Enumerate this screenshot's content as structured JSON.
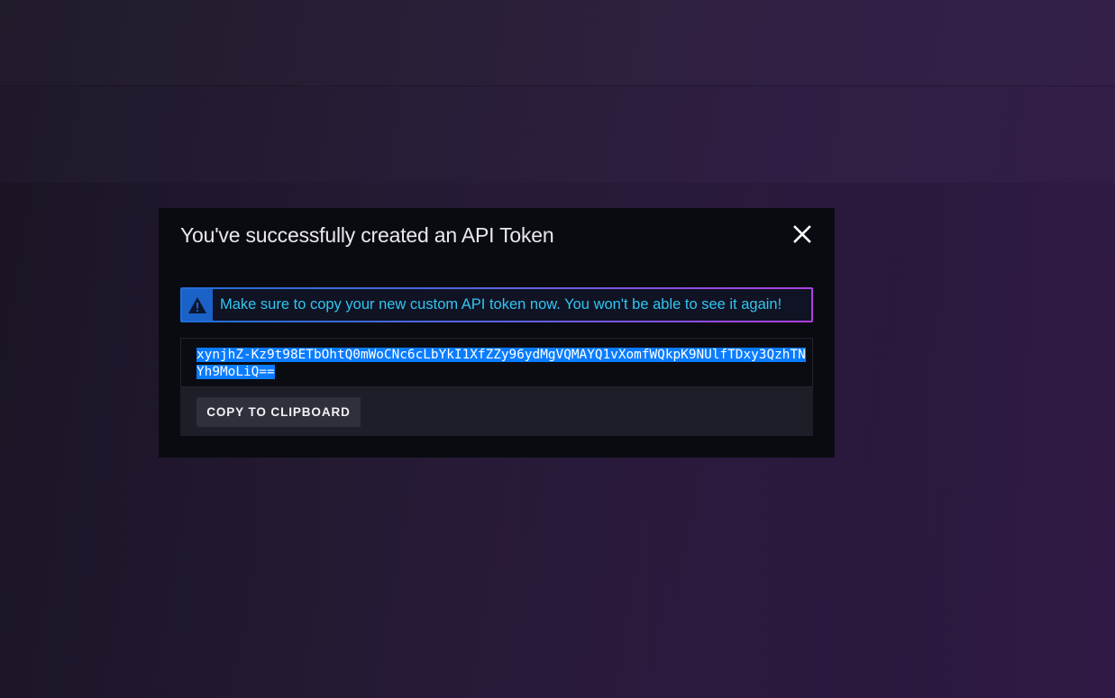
{
  "modal": {
    "title": "You've successfully created an API Token",
    "close_icon": "close-icon"
  },
  "alert": {
    "icon": "warning-triangle-icon",
    "message": "Make sure to copy your new custom API token now. You won't be able to see it again!",
    "colors": {
      "icon_bg": "#1a62c8",
      "text": "#33c5f0",
      "border_start": "#1f6fd6",
      "border_end": "#b041e0"
    }
  },
  "token": {
    "value": "xynjhZ-Kz9t98ETbOhtQ0mWoCNc6cLbYkI1XfZZy96ydMgVQMAYQ1vXomfWQkpK9NUlfTDxy3QzhTNYh9MoLiQ==",
    "selected": true,
    "selection_color": "#0a7cff"
  },
  "actions": {
    "copy_label": "COPY TO CLIPBOARD"
  },
  "colors": {
    "modal_bg": "#0a0b11",
    "page_bg": "#2c1b40"
  }
}
